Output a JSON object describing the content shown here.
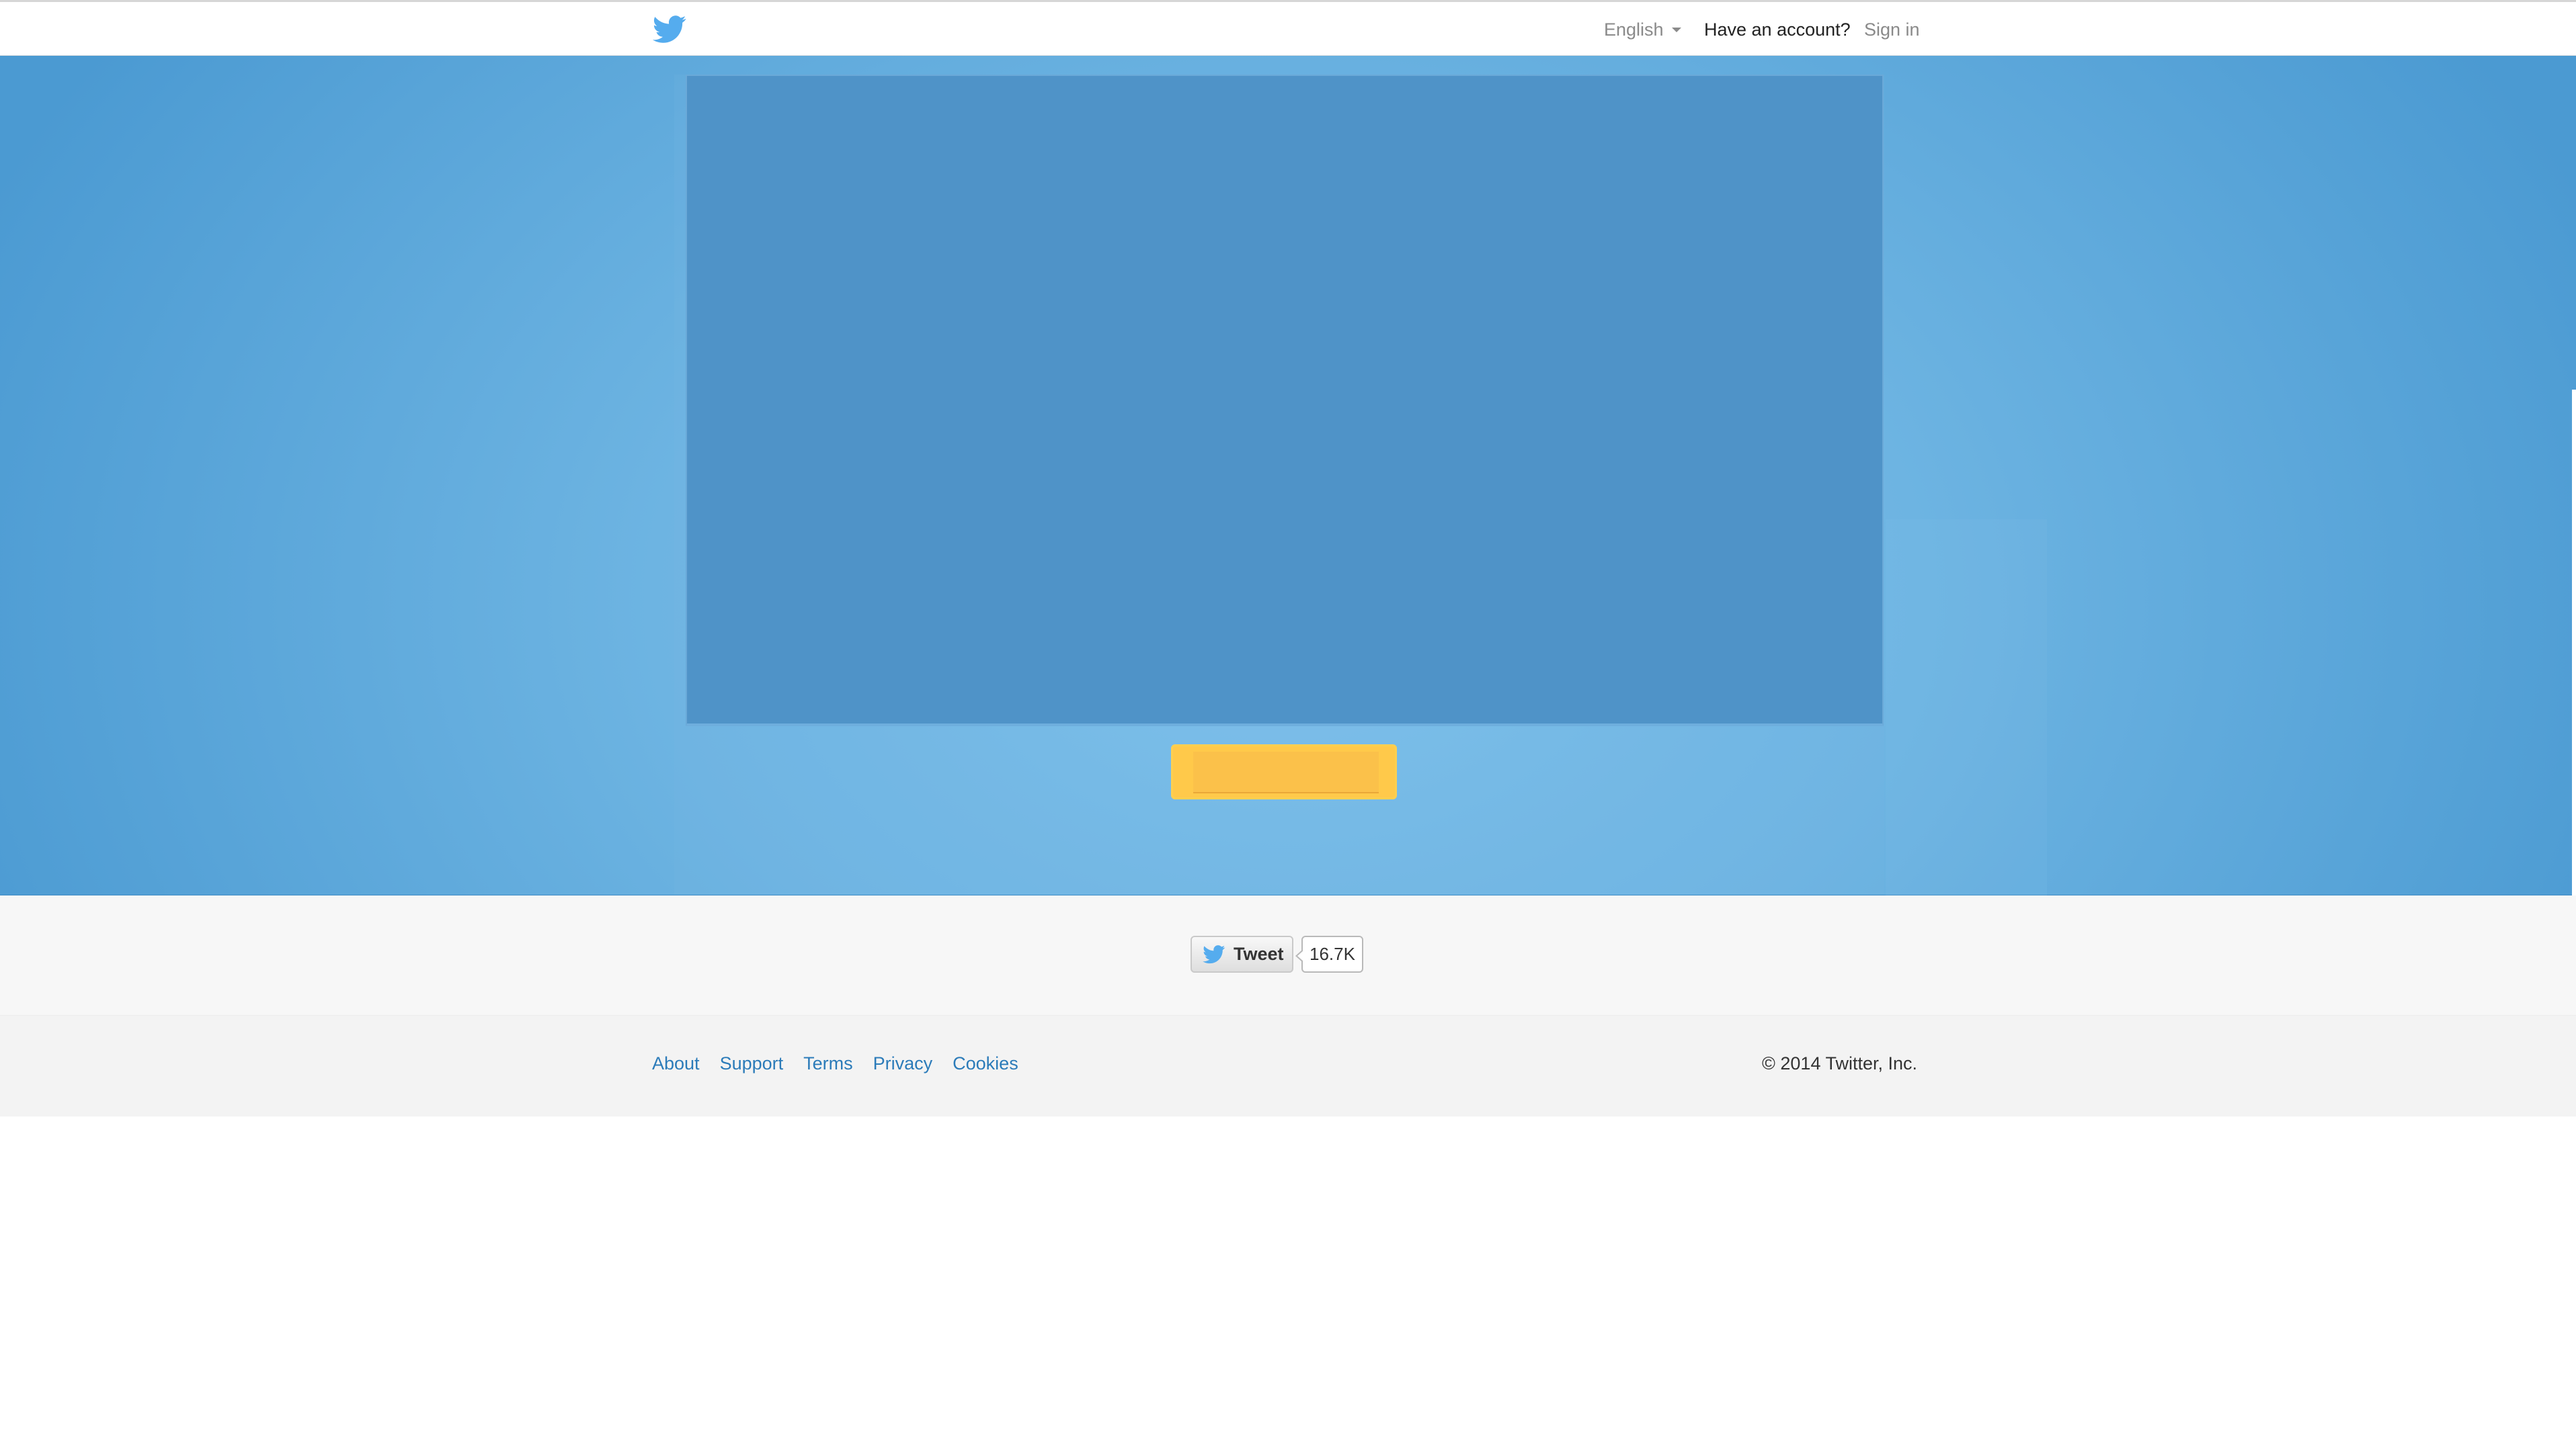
{
  "header": {
    "language_label": "English",
    "have_account_text": "Have an account?",
    "signin_label": "Sign in"
  },
  "tweet": {
    "button_label": "Tweet",
    "count": "16.7K"
  },
  "footer": {
    "links": [
      "About",
      "Support",
      "Terms",
      "Privacy",
      "Cookies"
    ],
    "copyright": "© 2014 Twitter, Inc."
  },
  "colors": {
    "brand_blue": "#55acee",
    "link_blue": "#2b7bb9",
    "cta_yellow": "#fbc14a",
    "hero_blue": "#4f93c8"
  },
  "icons": {
    "logo": "twitter-bird-icon",
    "dropdown": "caret-down-icon"
  }
}
